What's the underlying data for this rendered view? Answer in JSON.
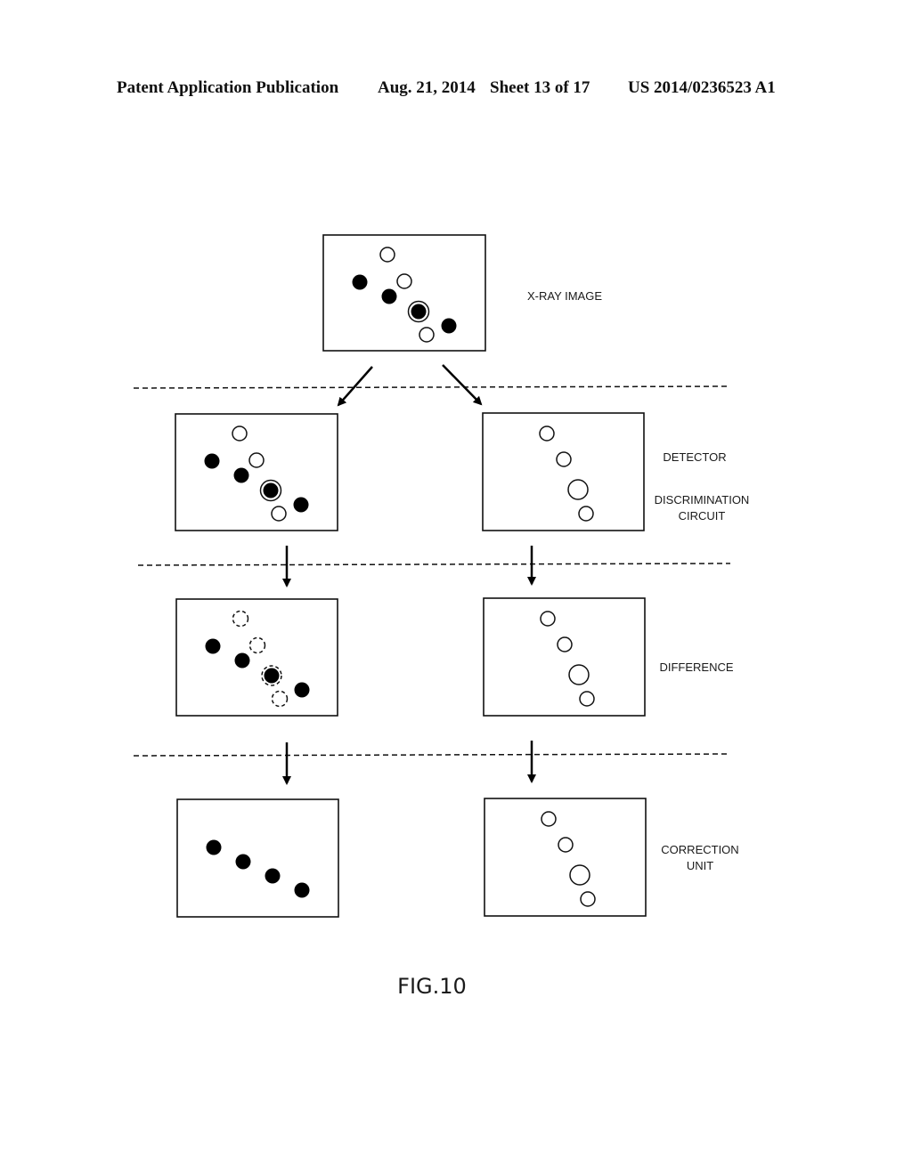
{
  "header": {
    "publication": "Patent Application Publication",
    "date": "Aug. 21, 2014",
    "sheet": "Sheet 13 of 17",
    "number": "US 2014/0236523 A1"
  },
  "figure": {
    "label": "FIG.10",
    "stage_labels": {
      "xray_image": "X-RAY IMAGE",
      "detector_line1": "DETECTOR",
      "detector_line2": "DISCRIMINATION",
      "detector_line3": "CIRCUIT",
      "difference": "DIFFERENCE",
      "correction_line1": "CORRECTION",
      "correction_line2": "UNIT"
    },
    "panels": [
      {
        "id": "xray",
        "dots": [
          {
            "type": "open",
            "size": "small"
          },
          {
            "type": "filled"
          },
          {
            "type": "open",
            "size": "small"
          },
          {
            "type": "filled"
          },
          {
            "type": "filled-ringed"
          },
          {
            "type": "open",
            "size": "small"
          },
          {
            "type": "filled"
          }
        ]
      },
      {
        "id": "left-row1",
        "dots": [
          {
            "type": "open",
            "size": "small"
          },
          {
            "type": "filled"
          },
          {
            "type": "open",
            "size": "small"
          },
          {
            "type": "filled"
          },
          {
            "type": "filled-ringed"
          },
          {
            "type": "open",
            "size": "small"
          },
          {
            "type": "filled"
          }
        ]
      },
      {
        "id": "right-row1",
        "dots": [
          {
            "type": "open",
            "size": "small"
          },
          {
            "type": "open",
            "size": "small"
          },
          {
            "type": "open",
            "size": "large"
          },
          {
            "type": "open",
            "size": "small"
          }
        ]
      },
      {
        "id": "left-row2",
        "dots": [
          {
            "type": "dashed"
          },
          {
            "type": "filled"
          },
          {
            "type": "dashed"
          },
          {
            "type": "filled"
          },
          {
            "type": "filled-dashed-ring"
          },
          {
            "type": "dashed"
          },
          {
            "type": "filled"
          }
        ]
      },
      {
        "id": "right-row2",
        "dots": [
          {
            "type": "open",
            "size": "small"
          },
          {
            "type": "open",
            "size": "small"
          },
          {
            "type": "open",
            "size": "large"
          },
          {
            "type": "open",
            "size": "small"
          }
        ]
      },
      {
        "id": "left-row3",
        "dots": [
          {
            "type": "filled"
          },
          {
            "type": "filled"
          },
          {
            "type": "filled"
          },
          {
            "type": "filled"
          }
        ]
      },
      {
        "id": "right-row3",
        "dots": [
          {
            "type": "open",
            "size": "small"
          },
          {
            "type": "open",
            "size": "small"
          },
          {
            "type": "open",
            "size": "large"
          },
          {
            "type": "open",
            "size": "small"
          }
        ]
      }
    ]
  }
}
